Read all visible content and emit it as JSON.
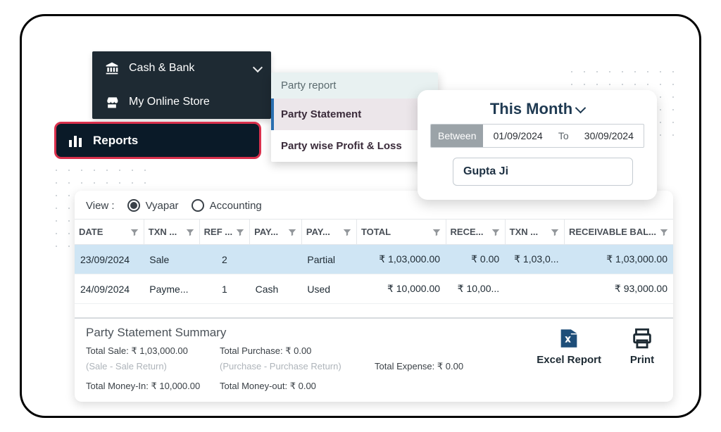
{
  "sidebar": {
    "items": [
      {
        "label": "Cash & Bank",
        "icon": "bank"
      },
      {
        "label": "My Online Store",
        "icon": "store"
      }
    ],
    "selected": {
      "label": "Reports"
    }
  },
  "submenu": {
    "title": "Party report",
    "items": [
      {
        "label": "Party Statement",
        "active": true
      },
      {
        "label": "Party wise Profit & Loss",
        "active": false
      }
    ]
  },
  "dateFilter": {
    "periodLabel": "This Month",
    "betweenLabel": "Between",
    "toLabel": "To",
    "from": "01/09/2024",
    "to": "30/09/2024",
    "partyName": "Gupta Ji"
  },
  "view": {
    "label": "View :",
    "options": {
      "a": "Vyapar",
      "b": "Accounting"
    },
    "selected": "a"
  },
  "table": {
    "headers": {
      "date": "DATE",
      "txnType": "TXN ...",
      "ref": "REF ...",
      "payType": "PAY...",
      "payStatus": "PAY...",
      "total": "TOTAL",
      "received": "RECE...",
      "txnBal": "TXN ...",
      "recvBal": "RECEIVABLE BAL..."
    },
    "rows": [
      {
        "date": "23/09/2024",
        "txnType": "Sale",
        "ref": "2",
        "payType": "",
        "payStatus": "Partial",
        "payStatusClass": "stat-partial",
        "total": "₹ 1,03,000.00",
        "received": "₹ 0.00",
        "txnBal": "₹ 1,03,0...",
        "recvBal": "₹ 1,03,000.00",
        "selected": true
      },
      {
        "date": "24/09/2024",
        "txnType": "Payme...",
        "ref": "1",
        "payType": "Cash",
        "payStatus": "Used",
        "payStatusClass": "stat-used",
        "total": "₹ 10,000.00",
        "received": "₹ 10,00...",
        "txnBal": "",
        "recvBal": "₹ 93,000.00",
        "selected": false
      }
    ]
  },
  "summary": {
    "title": "Party Statement Summary",
    "totalSale": "Total Sale: ₹ 1,03,000.00",
    "saleReturnNote": "(Sale - Sale Return)",
    "totalPurchase": "Total Purchase: ₹ 0.00",
    "purchaseReturnNote": "(Purchase - Purchase Return)",
    "totalExpense": "Total Expense: ₹ 0.00",
    "moneyIn": "Total Money-In: ₹ 10,000.00",
    "moneyOut": "Total Money-out: ₹ 0.00"
  },
  "actions": {
    "excel": "Excel Report",
    "print": "Print"
  }
}
